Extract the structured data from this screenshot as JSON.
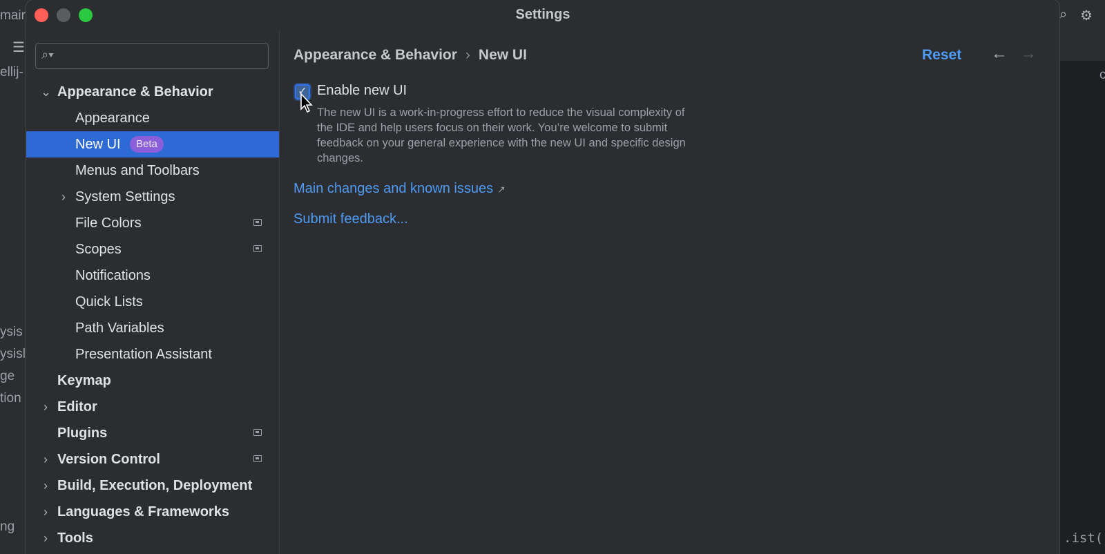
{
  "window": {
    "title": "Settings"
  },
  "background": {
    "left_fragments": [
      "mair",
      "ellij-",
      "ysis",
      "ysisl",
      "ge",
      "tion",
      "ng"
    ],
    "right_fragments": [
      "c",
      ".ist()"
    ]
  },
  "search": {
    "placeholder": "",
    "value": ""
  },
  "sidebar": {
    "items": [
      {
        "label": "Appearance & Behavior",
        "level": 0,
        "expanded": true,
        "bold": true
      },
      {
        "label": "Appearance",
        "level": 1
      },
      {
        "label": "New UI",
        "level": 1,
        "selected": true,
        "badge": "Beta"
      },
      {
        "label": "Menus and Toolbars",
        "level": 1
      },
      {
        "label": "System Settings",
        "level": 1,
        "collapsed": true
      },
      {
        "label": "File Colors",
        "level": 1,
        "project_icon": true
      },
      {
        "label": "Scopes",
        "level": 1,
        "project_icon": true
      },
      {
        "label": "Notifications",
        "level": 1
      },
      {
        "label": "Quick Lists",
        "level": 1
      },
      {
        "label": "Path Variables",
        "level": 1
      },
      {
        "label": "Presentation Assistant",
        "level": 1
      },
      {
        "label": "Keymap",
        "level": 0,
        "bold": true
      },
      {
        "label": "Editor",
        "level": 0,
        "bold": true,
        "collapsed": true
      },
      {
        "label": "Plugins",
        "level": 0,
        "bold": true,
        "project_icon": true
      },
      {
        "label": "Version Control",
        "level": 0,
        "bold": true,
        "collapsed": true,
        "project_icon": true
      },
      {
        "label": "Build, Execution, Deployment",
        "level": 0,
        "bold": true,
        "collapsed": true
      },
      {
        "label": "Languages & Frameworks",
        "level": 0,
        "bold": true,
        "collapsed": true
      },
      {
        "label": "Tools",
        "level": 0,
        "bold": true,
        "collapsed": true
      }
    ]
  },
  "content": {
    "breadcrumb": {
      "parent": "Appearance & Behavior",
      "separator": "›",
      "current": "New UI"
    },
    "reset_label": "Reset",
    "back_icon": "←",
    "forward_icon": "→",
    "enable_checkbox": {
      "label": "Enable new UI",
      "checked": true
    },
    "description": "The new UI is a work-in-progress effort to reduce the visual complexity of the IDE and help users focus on their work. You’re welcome to submit feedback on your general experience with the new UI and specific design changes.",
    "link_changes": "Main changes and known issues",
    "link_changes_icon": "↗",
    "link_feedback": "Submit feedback..."
  },
  "colors": {
    "accent": "#3574f0",
    "link": "#4e9cf6",
    "selection": "#2e6ad6",
    "badge": "#8a5fd9"
  }
}
